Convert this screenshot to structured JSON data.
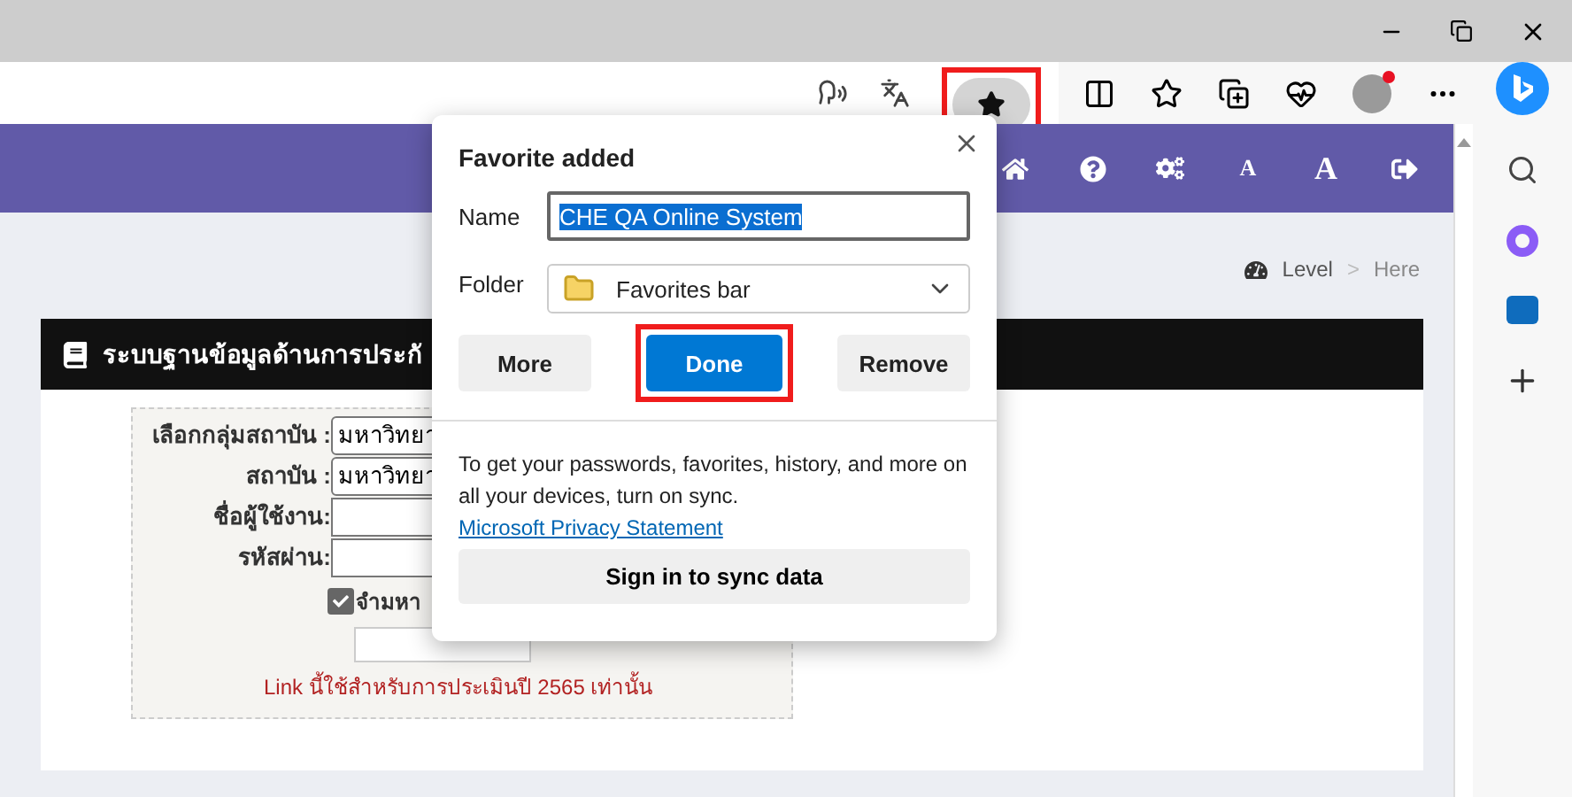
{
  "toolbar": {
    "favorites_button": {
      "selected": true,
      "highlighted": true
    }
  },
  "site_nav": [
    {
      "kind": "home"
    },
    {
      "kind": "help"
    },
    {
      "kind": "settings"
    },
    {
      "kind": "font_small",
      "label": "A"
    },
    {
      "kind": "font_large",
      "label": "A"
    },
    {
      "kind": "logout"
    }
  ],
  "breadcrumb": {
    "items": [
      "Level",
      "Here"
    ],
    "separator": ">"
  },
  "card": {
    "title": "ระบบฐานข้อมูลด้านการประกั"
  },
  "login_form": {
    "fields": [
      {
        "label": "เลือกกลุ่มสถาบัน :",
        "kind": "select",
        "value": "มหาวิทยา"
      },
      {
        "label": "สถาบัน :",
        "kind": "select",
        "value": "มหาวิทยา"
      },
      {
        "label": "ชื่อผู้ใช้งาน:",
        "kind": "text"
      },
      {
        "label": "รหัสผ่าน:",
        "kind": "password"
      }
    ],
    "remember": {
      "label": "จำมหา",
      "checked": true
    },
    "note": "Link นี้ใช้สำหรับการประเมินปี 2565 เท่านั้น"
  },
  "favorite_popup": {
    "title": "Favorite added",
    "name_label": "Name",
    "name_value": "CHE QA Online System",
    "name_selected": true,
    "folder_label": "Folder",
    "folder_value": "Favorites bar",
    "buttons": [
      {
        "label": "More",
        "kind": "secondary",
        "highlighted": false
      },
      {
        "label": "Done",
        "kind": "primary",
        "highlighted": true
      },
      {
        "label": "Remove",
        "kind": "secondary",
        "highlighted": false
      }
    ],
    "sync_text": "To get your passwords, favorites, history, and more on all your devices, turn on sync.",
    "privacy_link": "Microsoft Privacy Statement",
    "sign_in_button": "Sign in to sync data"
  }
}
